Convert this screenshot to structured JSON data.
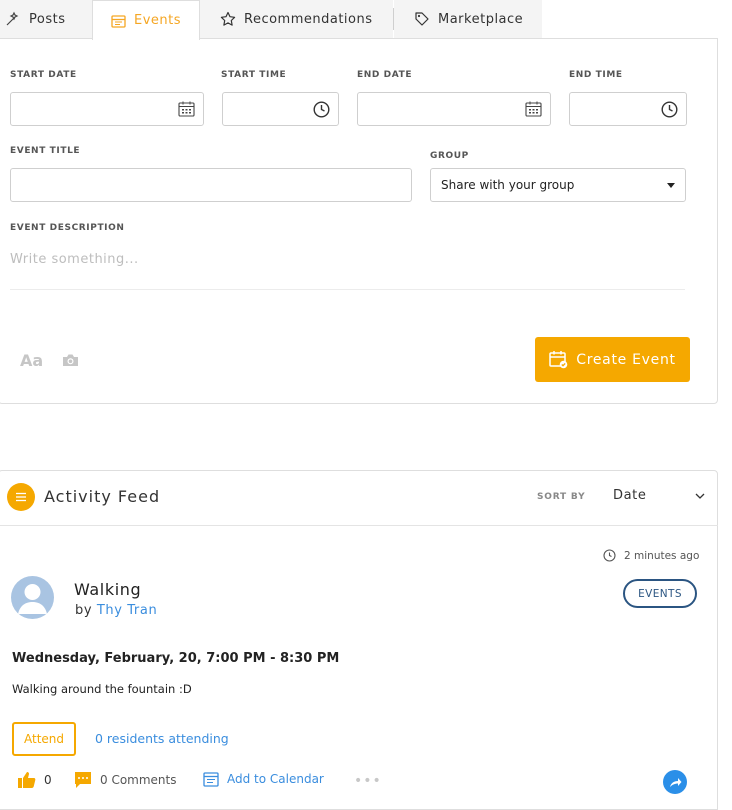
{
  "tabs": [
    {
      "label": "Posts",
      "icon": "magic-wand-icon"
    },
    {
      "label": "Events",
      "icon": "calendar-icon",
      "active": true
    },
    {
      "label": "Recommendations",
      "icon": "star-icon"
    },
    {
      "label": "Marketplace",
      "icon": "tag-icon"
    }
  ],
  "form": {
    "start_date_label": "START DATE",
    "start_time_label": "START TIME",
    "end_date_label": "END DATE",
    "end_time_label": "END TIME",
    "event_title_label": "EVENT TITLE",
    "group_label": "GROUP",
    "group_value": "Share with your group",
    "description_label": "EVENT DESCRIPTION",
    "description_placeholder": "Write something...",
    "text_format_label": "Aa",
    "create_button": "Create Event"
  },
  "feed": {
    "title": "Activity Feed",
    "sort_by_label": "SORT BY",
    "sort_value": "Date"
  },
  "post": {
    "time_ago": "2 minutes ago",
    "title": "Walking",
    "by_prefix": "by",
    "author": "Thy Tran",
    "badge": "EVENTS",
    "when": "Wednesday, February, 20, 7:00 PM - 8:30 PM",
    "description": "Walking around the fountain :D",
    "attend_label": "Attend",
    "attending_text": "0 residents attending",
    "likes": "0",
    "comments": "0 Comments",
    "add_to_calendar": "Add to Calendar",
    "more": "•••"
  },
  "colors": {
    "accent": "#f5a800",
    "link": "#3a8dde",
    "badge": "#2b5582"
  }
}
